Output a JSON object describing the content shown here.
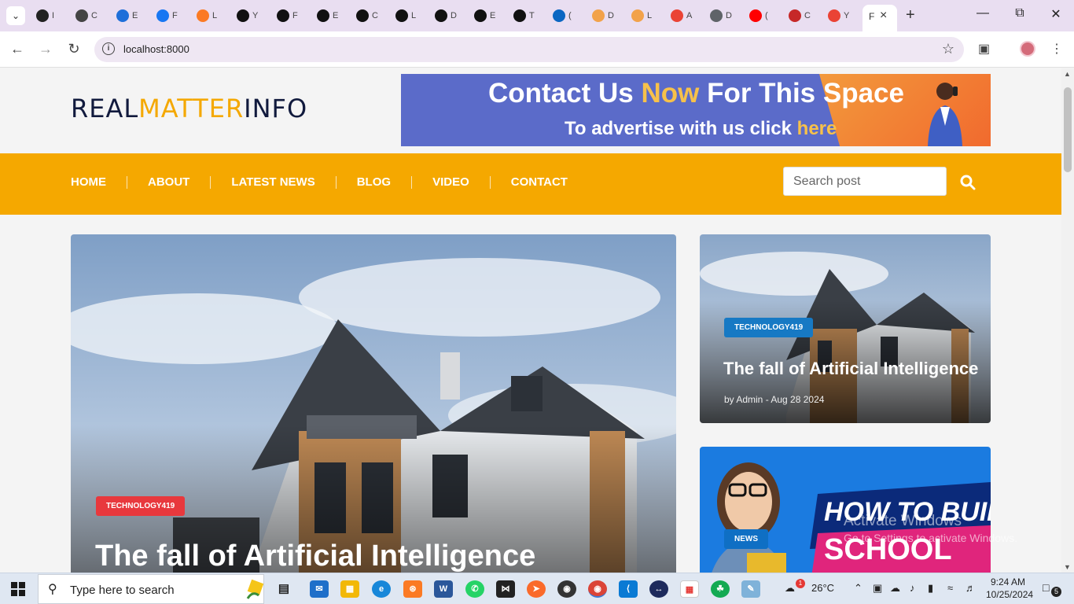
{
  "browser": {
    "tabs": [
      {
        "letter": "I",
        "color": "#222222"
      },
      {
        "letter": "C",
        "color": "#444444"
      },
      {
        "letter": "E",
        "color": "#1e6fd9"
      },
      {
        "letter": "F",
        "color": "#1877f2"
      },
      {
        "letter": "L",
        "color": "#fb7a24"
      },
      {
        "letter": "Y",
        "color": "#111111"
      },
      {
        "letter": "F",
        "color": "#111111"
      },
      {
        "letter": "E",
        "color": "#111111"
      },
      {
        "letter": "C",
        "color": "#111111"
      },
      {
        "letter": "L",
        "color": "#111111"
      },
      {
        "letter": "D",
        "color": "#111111"
      },
      {
        "letter": "E",
        "color": "#111111"
      },
      {
        "letter": "T",
        "color": "#111111"
      },
      {
        "letter": "(",
        "color": "#0a66c2"
      },
      {
        "letter": "D",
        "color": "#f2a24a"
      },
      {
        "letter": "L",
        "color": "#f2a24a"
      },
      {
        "letter": "A",
        "color": "#ea4335"
      },
      {
        "letter": "D",
        "color": "#5f6368"
      },
      {
        "letter": "(",
        "color": "#ff0000"
      },
      {
        "letter": "C",
        "color": "#c62828"
      },
      {
        "letter": "Y",
        "color": "#ea4335"
      }
    ],
    "active_tab": {
      "letter": "F"
    },
    "url": "localhost:8000"
  },
  "site": {
    "logo": {
      "part1": "REAL",
      "part2": "MATTER",
      "part3": "INFO"
    },
    "banner": {
      "line1_a": "Contact Us ",
      "line1_hl": "Now",
      "line1_b": " For This Space",
      "line2_a": "To advertise with us click ",
      "line2_hl": "here"
    },
    "nav": [
      "HOME",
      "ABOUT",
      "LATEST NEWS",
      "BLOG",
      "VIDEO",
      "CONTACT"
    ],
    "search_placeholder": "Search post"
  },
  "posts": {
    "main": {
      "category": "TECHNOLOGY419",
      "title": "The fall of Artificial Intelligence"
    },
    "side1": {
      "category": "TECHNOLOGY419",
      "title": "The fall of Artificial Intelligence",
      "meta": "by Admin - Aug 28 2024"
    },
    "side2": {
      "category": "NEWS",
      "image_text_1": "HOW TO BUILD",
      "image_text_2": "SCHOOL"
    }
  },
  "watermark": {
    "line1": "Activate Windows",
    "line2": "Go to Settings to activate Windows."
  },
  "taskbar": {
    "search_text": "Type here to search",
    "temperature": "26°C",
    "weather_badge": "1",
    "time": "9:24 AM",
    "date": "10/25/2024",
    "notifications": "5"
  },
  "colors": {
    "accent": "#f5a800",
    "brand_dark": "#111a3d",
    "badge_red": "#e8383d",
    "badge_blue": "#1779c4"
  }
}
